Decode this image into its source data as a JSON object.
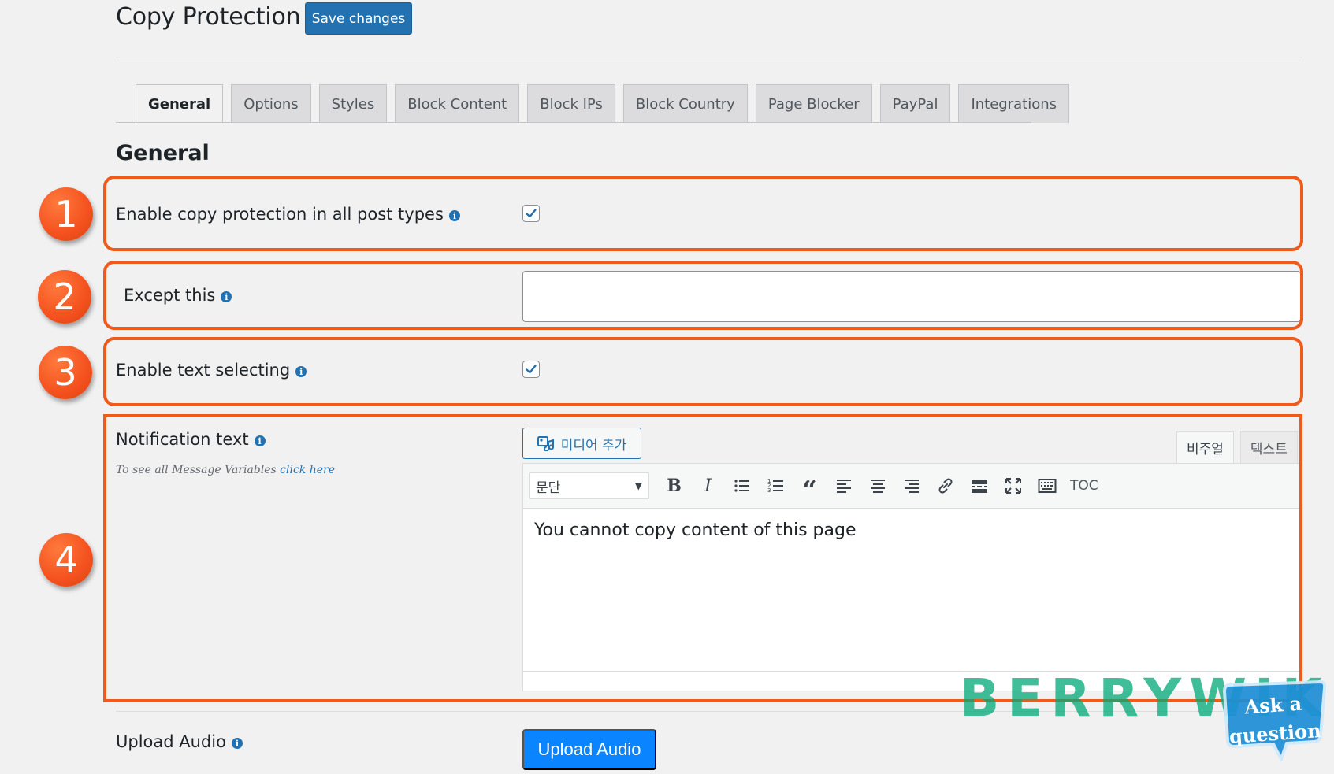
{
  "header": {
    "title": "Copy Protection",
    "save_label": "Save changes"
  },
  "tabs": [
    {
      "label": "General",
      "active": true
    },
    {
      "label": "Options"
    },
    {
      "label": "Styles"
    },
    {
      "label": "Block Content"
    },
    {
      "label": "Block IPs"
    },
    {
      "label": "Block Country"
    },
    {
      "label": "Page Blocker"
    },
    {
      "label": "PayPal"
    },
    {
      "label": "Integrations"
    }
  ],
  "section": {
    "title": "General"
  },
  "rows": {
    "enable_copy": {
      "label": "Enable copy protection in all post types",
      "checked": true
    },
    "except_this": {
      "label": "Except this",
      "value": ""
    },
    "enable_text": {
      "label": "Enable text selecting",
      "checked": true
    },
    "notification": {
      "label": "Notification text",
      "sub_prefix": "To see all Message Variables",
      "sub_link": "click here",
      "media_button": "미디어 추가",
      "mode_tabs": [
        "비주얼",
        "텍스트"
      ],
      "format_select": "문단",
      "toc_label": "TOC",
      "content": "You cannot copy content of this page"
    },
    "upload_audio": {
      "label": "Upload Audio",
      "button": "Upload Audio"
    }
  },
  "badges": [
    "1",
    "2",
    "3",
    "4"
  ],
  "watermark": {
    "text": "BERRYWIKI",
    "ask_line1": "Ask a",
    "ask_line2": "question"
  },
  "colors": {
    "accent": "#2271b1",
    "highlight": "#f05a1a",
    "upload": "#0a84ff",
    "watermark": "#00a878"
  }
}
